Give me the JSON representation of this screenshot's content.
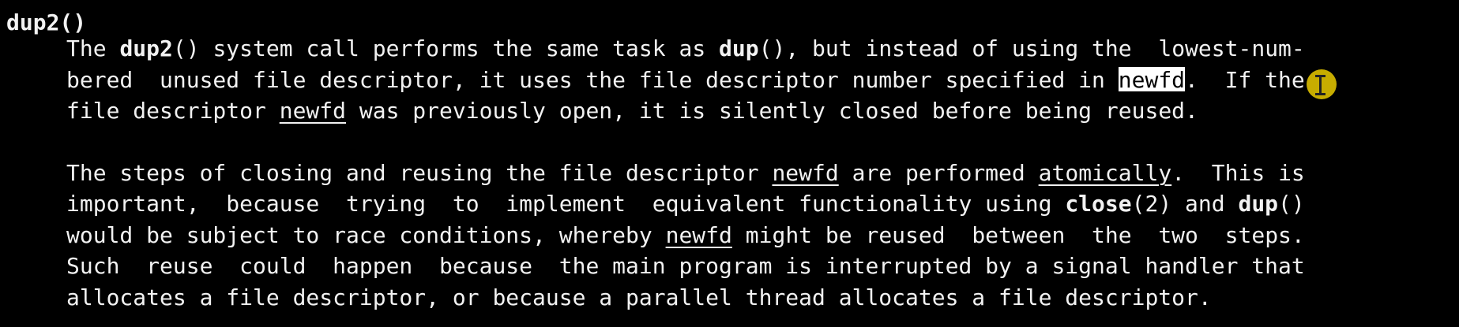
{
  "heading": "dup2()",
  "paragraph1": {
    "line1": {
      "t1": "The ",
      "b1": "dup2",
      "t2": "() system call performs the same task as ",
      "b2": "dup",
      "t3": "(), but instead of using the  lowest-num‐"
    },
    "line2": {
      "t1": "bered  unused file descriptor, it uses the file descriptor number specified in ",
      "hl": "newfd",
      "t2": ".  If the"
    },
    "line3": {
      "t1": "file descriptor ",
      "u1": "newfd",
      "t2": " was previously open, it is silently closed before being reused."
    }
  },
  "paragraph2": {
    "line1": {
      "t1": "The steps of closing and reusing the file descriptor ",
      "u1": "newfd",
      "t2": " are performed ",
      "u2": "atomically",
      "t3": ".  This is"
    },
    "line2": {
      "t1": "important,  because  trying  to  implement  equivalent functionality using ",
      "b1": "close",
      "t2": "(2) and ",
      "b2": "dup",
      "t3": "()"
    },
    "line3": {
      "t1": "would be subject to race conditions, whereby ",
      "u1": "newfd",
      "t2": " might be reused  between  the  two  steps."
    },
    "line4": {
      "t1": "Such  reuse  could  happen  because  the main program is interrupted by a signal handler that"
    },
    "line5": {
      "t1": "allocates a file descriptor, or because a parallel thread allocates a file descriptor."
    }
  },
  "colors": {
    "background": "#000000",
    "text": "#f2f2f2",
    "selection_background": "#ffffff",
    "cursor_highlight": "#ffdd00"
  },
  "icons": {
    "cursor": "text-cursor-icon"
  }
}
